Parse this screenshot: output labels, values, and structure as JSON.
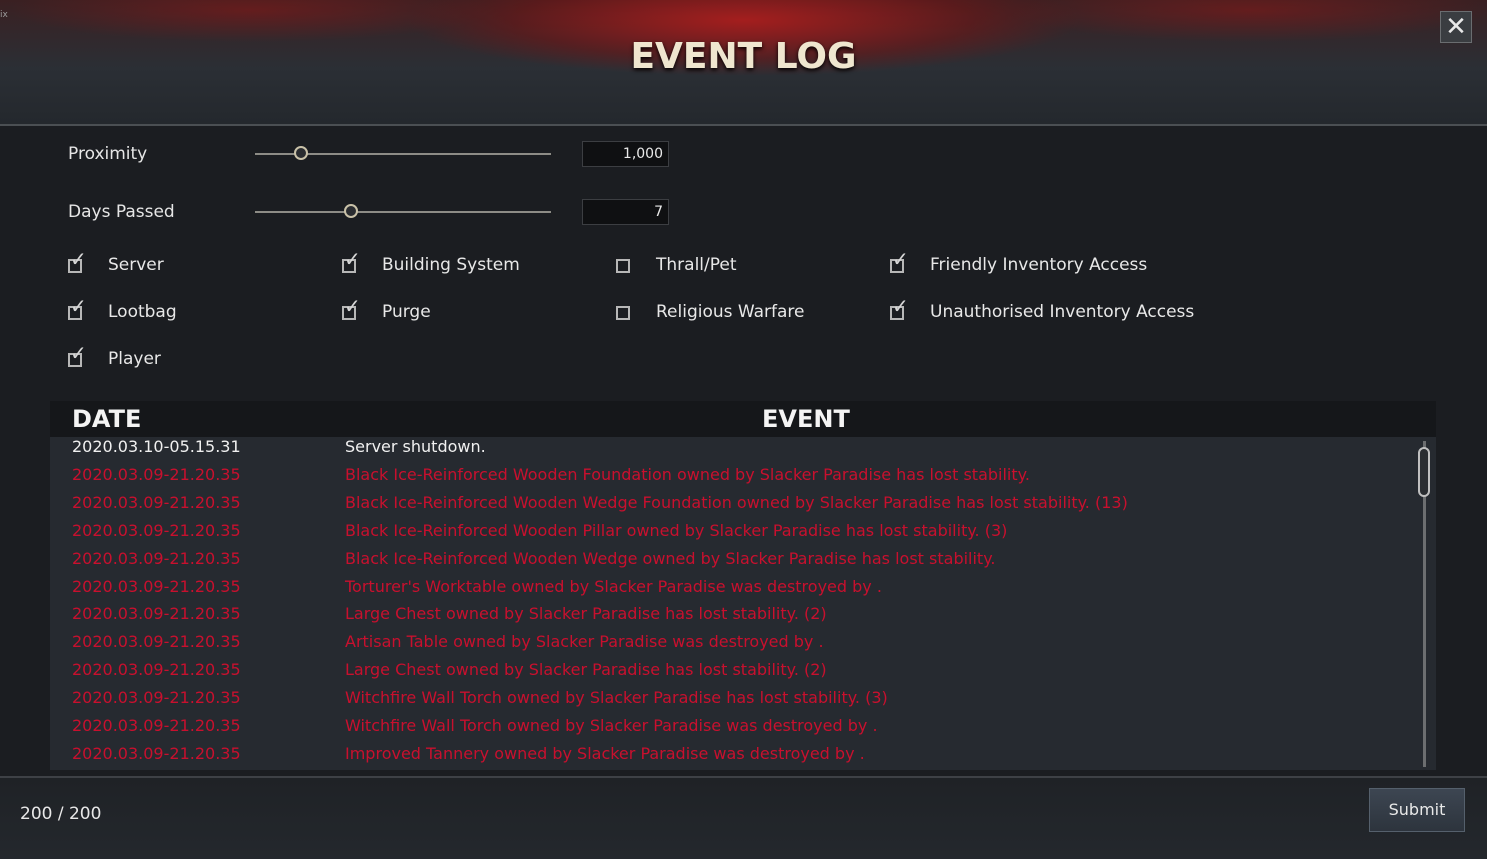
{
  "corner_text": "ix",
  "title": "EVENT LOG",
  "close_icon": "✕",
  "proximity": {
    "label": "Proximity",
    "value": "1,000",
    "slider_fraction": 0.155
  },
  "days_passed": {
    "label": "Days Passed",
    "value": "7",
    "slider_fraction": 0.325
  },
  "filters": [
    {
      "label": "Server",
      "checked": true
    },
    {
      "label": "Building System",
      "checked": true
    },
    {
      "label": "Thrall/Pet",
      "checked": false
    },
    {
      "label": "Friendly Inventory Access",
      "checked": true
    },
    {
      "label": "Lootbag",
      "checked": true
    },
    {
      "label": "Purge",
      "checked": true
    },
    {
      "label": "Religious Warfare",
      "checked": false
    },
    {
      "label": "Unauthorised Inventory Access",
      "checked": true
    },
    {
      "label": "Player",
      "checked": true
    }
  ],
  "table": {
    "date_header": "DATE",
    "event_header": "EVENT",
    "rows": [
      {
        "date": "2020.03.10-05.15.31",
        "event": "Server shutdown.",
        "color": "#f0f0f0"
      },
      {
        "date": "2020.03.09-21.20.35",
        "event": "Black Ice-Reinforced Wooden Foundation owned by Slacker Paradise has lost stability.",
        "color": "#c8102e"
      },
      {
        "date": "2020.03.09-21.20.35",
        "event": "Black Ice-Reinforced Wooden Wedge Foundation owned by Slacker Paradise has lost stability. (13)",
        "color": "#c8102e"
      },
      {
        "date": "2020.03.09-21.20.35",
        "event": "Black Ice-Reinforced Wooden Pillar owned by Slacker Paradise has lost stability. (3)",
        "color": "#c8102e"
      },
      {
        "date": "2020.03.09-21.20.35",
        "event": "Black Ice-Reinforced Wooden Wedge owned by Slacker Paradise has lost stability.",
        "color": "#c8102e"
      },
      {
        "date": "2020.03.09-21.20.35",
        "event": "Torturer's Worktable owned by Slacker Paradise was destroyed by .",
        "color": "#c8102e"
      },
      {
        "date": "2020.03.09-21.20.35",
        "event": "Large Chest owned by Slacker Paradise has lost stability. (2)",
        "color": "#c8102e"
      },
      {
        "date": "2020.03.09-21.20.35",
        "event": "Artisan Table owned by Slacker Paradise was destroyed by .",
        "color": "#c8102e"
      },
      {
        "date": "2020.03.09-21.20.35",
        "event": "Large Chest owned by Slacker Paradise has lost stability. (2)",
        "color": "#c8102e"
      },
      {
        "date": "2020.03.09-21.20.35",
        "event": "Witchfire Wall Torch owned by Slacker Paradise has lost stability. (3)",
        "color": "#c8102e"
      },
      {
        "date": "2020.03.09-21.20.35",
        "event": "Witchfire Wall Torch owned by Slacker Paradise was destroyed by .",
        "color": "#c8102e"
      },
      {
        "date": "2020.03.09-21.20.35",
        "event": "Improved Tannery owned by Slacker Paradise was destroyed by .",
        "color": "#c8102e"
      }
    ]
  },
  "footer": {
    "count": "200 / 200",
    "submit_label": "Submit"
  }
}
